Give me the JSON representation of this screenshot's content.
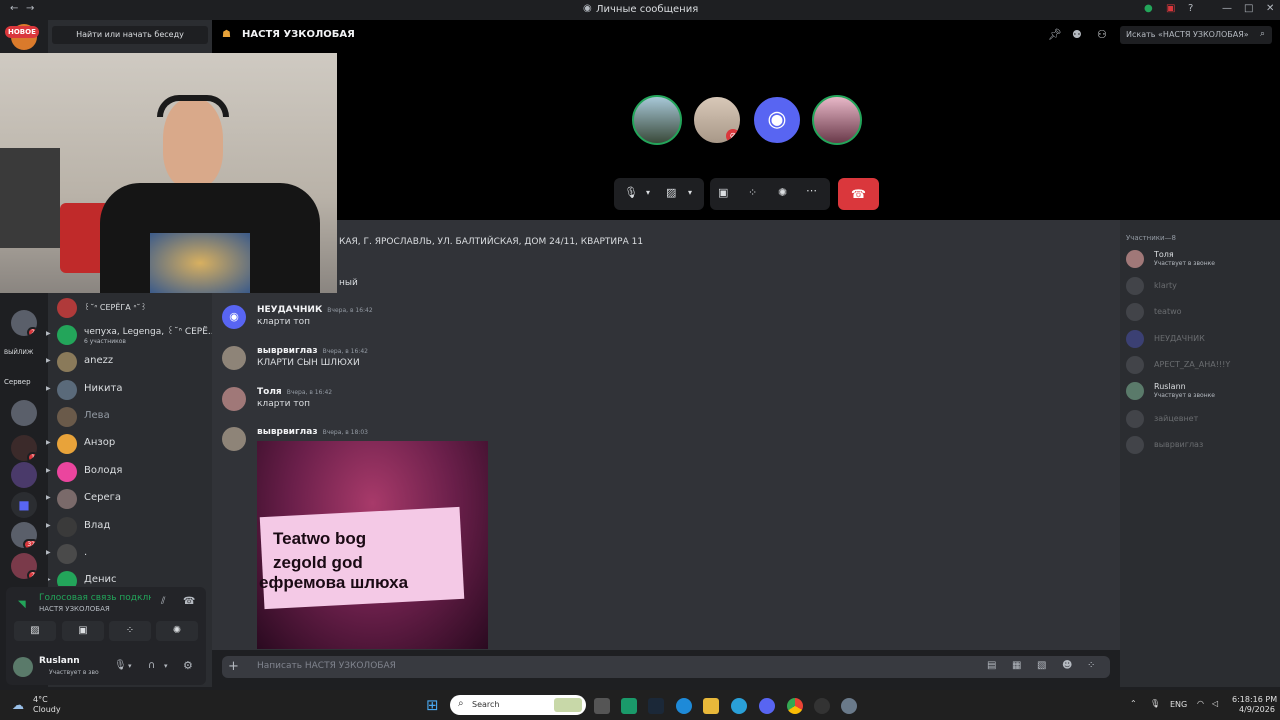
{
  "titlebar": {
    "title": "Личные сообщения",
    "icons": [
      "back-icon",
      "forward-icon",
      "discord-icon",
      "nitro-icon",
      "inbox-icon",
      "help-icon",
      "minimize-icon",
      "maximize-icon",
      "close-icon"
    ]
  },
  "servers": {
    "new_badge": "НОВОЕ",
    "labels": [
      "ВЫЙЛИЖ",
      "Сервер"
    ],
    "badges": [
      "2",
      "1",
      "32",
      "2"
    ]
  },
  "dm": {
    "search": "Найти или начать беседу",
    "items": [
      {
        "name": "꒰˘ᐢ СЕРЁГА ᐢ˘꒱",
        "sub": ""
      },
      {
        "name": "чепуха, Legenga, ꒰˘ᐢ СЕРЁ...",
        "sub": "6 участников"
      },
      {
        "name": "anezz",
        "sub": ""
      },
      {
        "name": "Никита",
        "sub": ""
      },
      {
        "name": "Лева",
        "sub": ""
      },
      {
        "name": "Анзор",
        "sub": ""
      },
      {
        "name": "Володя",
        "sub": ""
      },
      {
        "name": "Серега",
        "sub": ""
      },
      {
        "name": "Влад",
        "sub": ""
      },
      {
        "name": ".",
        "sub": ""
      },
      {
        "name": "Денис",
        "sub": ""
      }
    ]
  },
  "voice": {
    "status": "Голосовая связь подключ",
    "channel": "НАСТЯ УЗКОЛОБАЯ"
  },
  "user": {
    "name": "Ruslann",
    "status": "Участвует в зво"
  },
  "header": {
    "title": "НАСТЯ УЗКОЛОБАЯ",
    "search_placeholder": "Искать «НАСТЯ УЗКОЛОБАЯ»"
  },
  "chat": {
    "partial_line": "КАЯ, Г. ЯРОСЛАВЛЬ, УЛ. БАЛТИЙСКАЯ, ДОМ 24/11, КВАРТИРА 11",
    "partial_line2": "ный",
    "messages": [
      {
        "author": "НЕУДАЧНИК",
        "time": "Вчера, в 16:42",
        "text": "кларти топ"
      },
      {
        "author": "выврвиглаз",
        "time": "Вчера, в 16:42",
        "text": "КЛАРТИ СЫН ШЛЮХИ"
      },
      {
        "author": "Толя",
        "time": "Вчера, в 16:42",
        "text": "кларти топ"
      },
      {
        "author": "выврвиглаз",
        "time": "Вчера, в 18:03",
        "text": ""
      }
    ],
    "image_text": [
      "Teatwo bog",
      "zegold god",
      "ефремова шлюха"
    ],
    "composer_placeholder": "Написать НАСТЯ УЗКОЛОБАЯ"
  },
  "members": {
    "header": "Участники—8",
    "items": [
      {
        "name": "Толя",
        "status": "Участвует в звонке",
        "dim": false
      },
      {
        "name": "klarty",
        "status": "",
        "dim": true
      },
      {
        "name": "teatwo",
        "status": "",
        "dim": true
      },
      {
        "name": "НЕУДАЧНИК",
        "status": "",
        "dim": true
      },
      {
        "name": "APECT_ZA_AHA!!!Y",
        "status": "",
        "dim": true
      },
      {
        "name": "Ruslann",
        "status": "Участвует в звонке",
        "dim": false
      },
      {
        "name": "зайцевнет",
        "status": "",
        "dim": true
      },
      {
        "name": "выврвиглаз",
        "status": "",
        "dim": true
      }
    ]
  },
  "taskbar": {
    "weather_temp": "4°C",
    "weather_desc": "Cloudy",
    "search": "Search",
    "lang": "ENG",
    "time": "6:18:16 PM",
    "date": "4/9/2026"
  },
  "colors": {
    "accent": "#5865f2",
    "danger": "#da373c",
    "online": "#23a55a"
  }
}
